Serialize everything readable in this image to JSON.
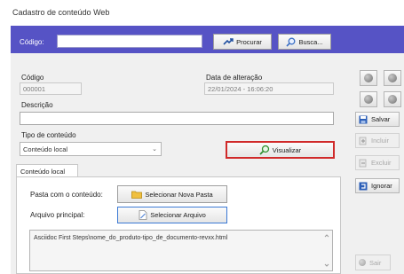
{
  "window": {
    "title": "Cadastro de conteúdo Web"
  },
  "search": {
    "label": "Código:",
    "value": "",
    "procurar_label": "Procurar",
    "busca_label": "Busca..."
  },
  "form": {
    "codigo_label": "Código",
    "codigo_value": "000001",
    "data_label": "Data de alteração",
    "data_value": "22/01/2024 - 16:06:20",
    "descricao_label": "Descrição",
    "descricao_value": "",
    "tipo_label": "Tipo de conteúdo",
    "tipo_value": "Conteúdo local",
    "visualizar_label": "Visualizar"
  },
  "tab": {
    "label": "Conteúdo local",
    "pasta_label": "Pasta com o conteúdo:",
    "pasta_button": "Selecionar Nova Pasta",
    "arquivo_label": "Arquivo principal:",
    "arquivo_button": "Selecionar Arquivo",
    "arquivo_path": "Asciidoc First Steps\\nome_do_produto-tipo_de_documento-revxx.html"
  },
  "side": {
    "salvar": "Salvar",
    "incluir": "Incluir",
    "excluir": "Excluir",
    "ignorar": "Ignorar",
    "sair": "Sair"
  },
  "colors": {
    "search_bar": "#5653c5",
    "highlight": "#d02a2a"
  }
}
